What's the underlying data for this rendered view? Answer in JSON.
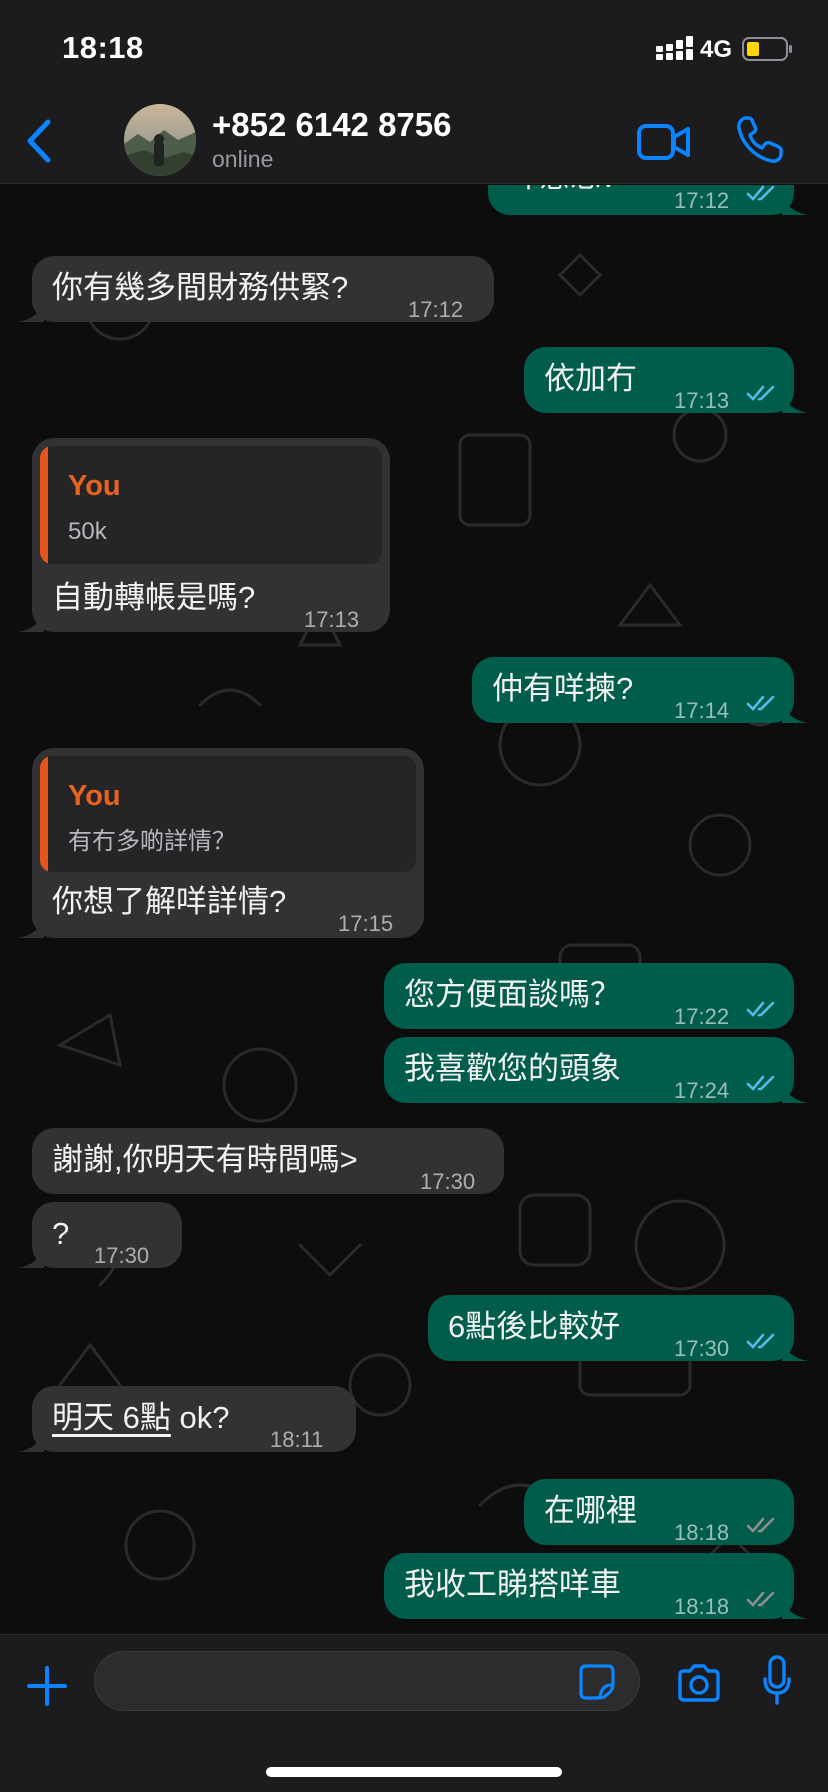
{
  "status_bar": {
    "time": "18:18",
    "network": "4G",
    "battery_color": "#ffd60a"
  },
  "header": {
    "contact_name": "+852 6142 8756",
    "contact_status": "online",
    "accent": "#0a84ff"
  },
  "messages": [
    {
      "dir": "out",
      "text": "咩意思？",
      "time": "17:12",
      "status": "read"
    },
    {
      "dir": "in",
      "text": "你有幾多間財務供緊?",
      "time": "17:12"
    },
    {
      "dir": "out",
      "text": "依加冇",
      "time": "17:13",
      "status": "read"
    },
    {
      "dir": "in",
      "text": "自動轉帳是嗎?",
      "time": "17:13",
      "quote": {
        "author": "You",
        "text": "50k"
      }
    },
    {
      "dir": "out",
      "text": "仲有咩揀?",
      "time": "17:14",
      "status": "read"
    },
    {
      "dir": "in",
      "text": "你想了解咩詳情?",
      "time": "17:15",
      "quote": {
        "author": "You",
        "text": "有冇多啲詳情？"
      }
    },
    {
      "dir": "out",
      "text": "您方便面談嗎？",
      "time": "17:22",
      "status": "read"
    },
    {
      "dir": "out",
      "text": "我喜歡您的頭象",
      "time": "17:24",
      "status": "read"
    },
    {
      "dir": "in",
      "text": "謝謝,你明天有時間嗎>",
      "time": "17:30"
    },
    {
      "dir": "in",
      "text": "?",
      "time": "17:30"
    },
    {
      "dir": "out",
      "text": "6點後比較好",
      "time": "17:30",
      "status": "read"
    },
    {
      "dir": "in",
      "text_underlined": "明天 6點",
      "text_rest": " ok?",
      "time": "18:11"
    },
    {
      "dir": "out",
      "text": "在哪裡",
      "time": "18:18",
      "status": "delivered"
    },
    {
      "dir": "out",
      "text": "我收工睇搭咩車",
      "time": "18:18",
      "status": "delivered"
    }
  ],
  "colors": {
    "incoming_bubble": "#323235",
    "outgoing_bubble": "#005c4b",
    "read_ticks": "#53bdeb",
    "delivered_ticks": "#8e8e93",
    "quote_accent": "#e8541e"
  },
  "input": {
    "placeholder": ""
  },
  "icons": [
    "back-chevron-icon",
    "video-camera-icon",
    "phone-icon",
    "plus-icon",
    "sticker-icon",
    "camera-icon",
    "microphone-icon"
  ]
}
